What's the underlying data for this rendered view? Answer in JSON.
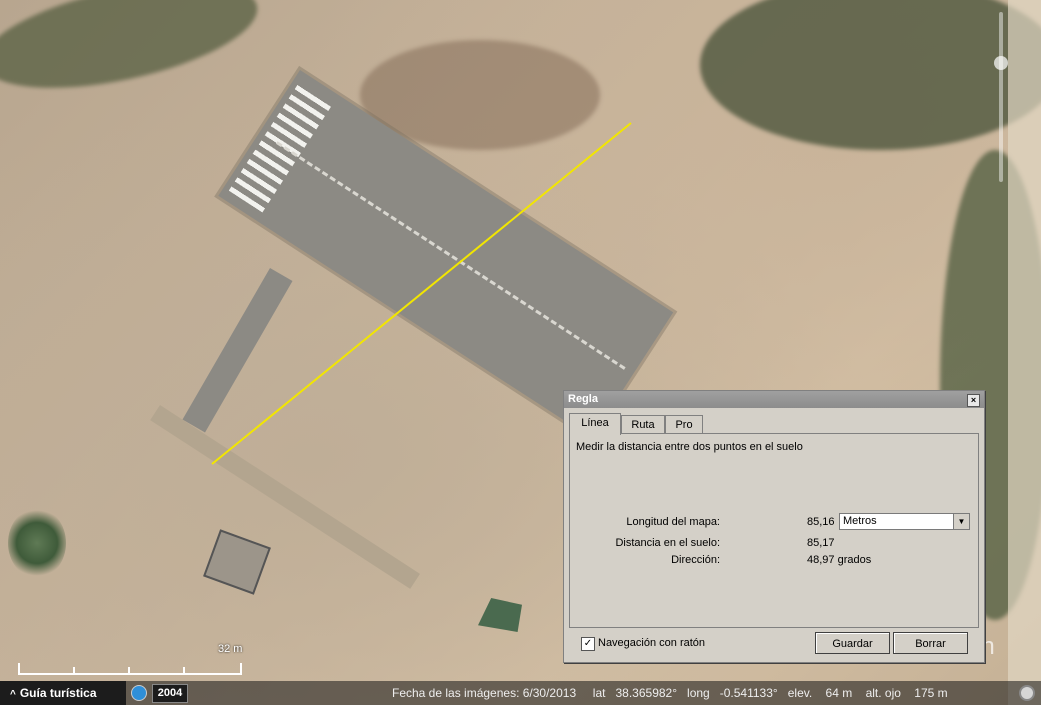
{
  "ruler": {
    "title": "Regla",
    "close": "×",
    "tabs": [
      "Línea",
      "Ruta",
      "Pro"
    ],
    "description": "Medir la distancia entre dos puntos en el suelo",
    "map_length_label": "Longitud del mapa:",
    "map_length_value": "85,16",
    "unit": "Metros",
    "ground_distance_label": "Distancia en el suelo:",
    "ground_distance_value": "85,17",
    "heading_label": "Dirección:",
    "heading_value": "48,97 grados",
    "mouse_nav_label": "Navegación con ratón",
    "mouse_nav_checked": true,
    "save_label": "Guardar",
    "clear_label": "Borrar"
  },
  "map": {
    "scale_label": "32 m",
    "logo_text": "earth",
    "measure_line_color": "#f2e600"
  },
  "statusbar": {
    "tour_guide": "Guía turística",
    "year": "2004",
    "imagery_date": "Fecha de las imágenes: 6/30/2013",
    "lat_label": "lat",
    "lat_value": "38.365982°",
    "long_label": "long",
    "long_value": "-0.541133°",
    "elev_label": "elev.",
    "elev_value": "64 m",
    "eye_alt_label": "alt. ojo",
    "eye_alt_value": "175 m"
  }
}
